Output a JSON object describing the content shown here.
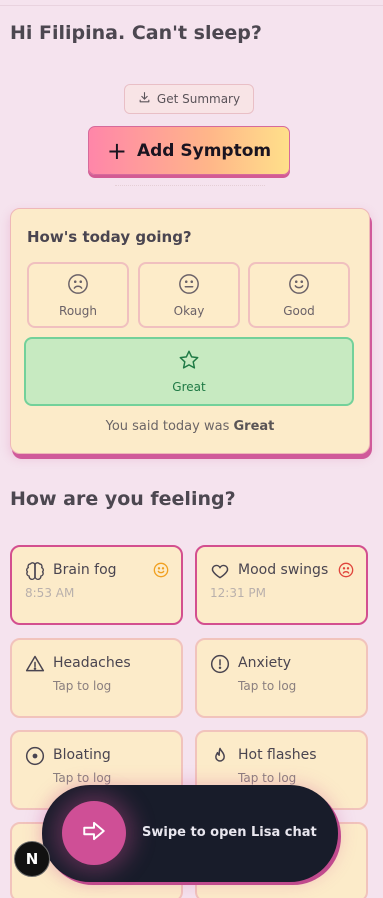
{
  "greeting": "Hi Filipina. Can't sleep?",
  "actions": {
    "summary_label": "Get Summary",
    "add_symptom_label": "Add Symptom"
  },
  "today": {
    "title": "How's today going?",
    "options": [
      {
        "label": "Rough",
        "icon": "frown-icon"
      },
      {
        "label": "Okay",
        "icon": "neutral-face-icon"
      },
      {
        "label": "Good",
        "icon": "smile-icon"
      },
      {
        "label": "Great",
        "icon": "star-icon"
      }
    ],
    "selected": "Great",
    "said_prefix": "You said today was",
    "said_value": "Great"
  },
  "feeling_title": "How are you feeling?",
  "symptoms": [
    {
      "name": "Brain fog",
      "sub": "8:53 AM",
      "icon": "brain-icon",
      "mood": "smile-icon",
      "mood_color": "#f0a020",
      "logged": true
    },
    {
      "name": "Mood swings",
      "sub": "12:31 PM",
      "icon": "heart-icon",
      "mood": "frown-icon",
      "mood_color": "#e0453c",
      "logged": true
    },
    {
      "name": "Headaches",
      "sub": "Tap to log",
      "icon": "warning-icon",
      "logged": false
    },
    {
      "name": "Anxiety",
      "sub": "Tap to log",
      "icon": "alert-circle-icon",
      "logged": false
    },
    {
      "name": "Bloating",
      "sub": "Tap to log",
      "icon": "circle-dot-icon",
      "logged": false
    },
    {
      "name": "Hot flashes",
      "sub": "Tap to log",
      "icon": "flame-icon",
      "logged": false
    }
  ],
  "chat": {
    "label": "Swipe to open Lisa chat"
  },
  "dev_badge": "N",
  "colors": {
    "accent_pink": "#cf4f96",
    "card_bg": "#fcebc9",
    "great_green": "#c7eac1",
    "chat_bg": "#181c2a"
  }
}
